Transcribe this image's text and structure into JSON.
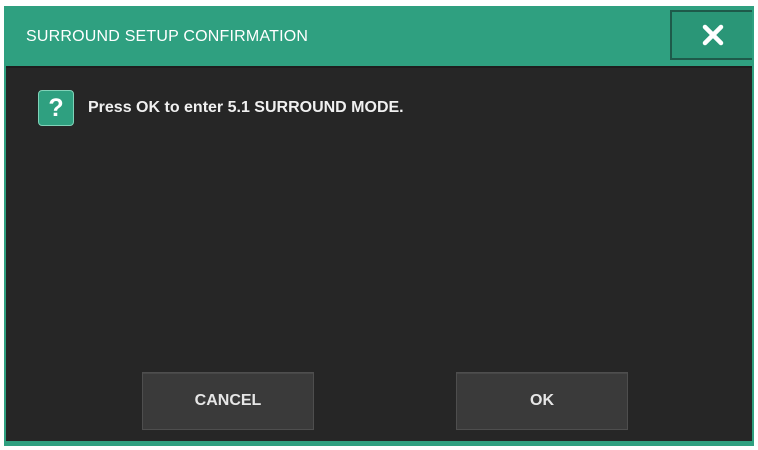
{
  "dialog": {
    "title": "SURROUND SETUP CONFIRMATION",
    "close_icon": "close-icon",
    "message_icon": "question-icon",
    "message_icon_glyph": "?",
    "message": "Press OK to enter 5.1 SURROUND MODE."
  },
  "buttons": {
    "cancel_label": "CANCEL",
    "ok_label": "OK"
  },
  "colors": {
    "accent": "#2fa080",
    "background": "#262626",
    "button": "#3a3a3a",
    "text": "#f0f0f0"
  }
}
